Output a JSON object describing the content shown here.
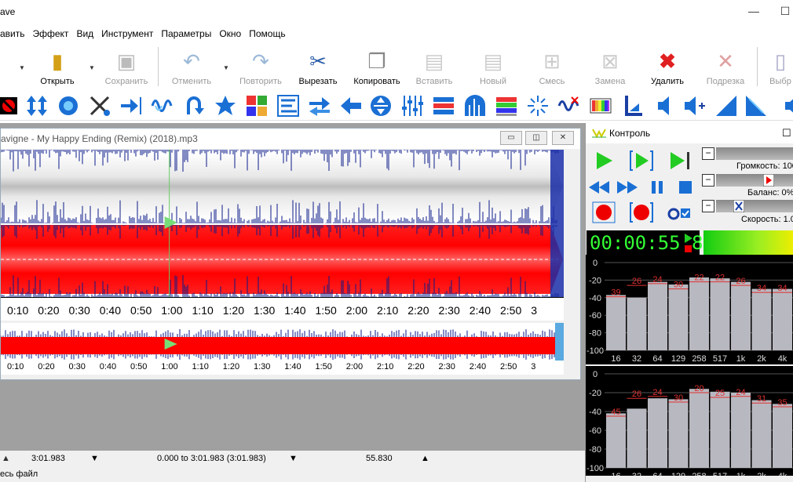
{
  "app": {
    "title": "ave"
  },
  "menu": [
    "авить",
    "Эффект",
    "Вид",
    "Инструмент",
    "Параметры",
    "Окно",
    "Помощь"
  ],
  "toolbar": {
    "open": "Открыть",
    "save": "Сохранить",
    "undo": "Отменить",
    "redo": "Повторить",
    "cut": "Вырезать",
    "copy": "Копировать",
    "paste": "Вставить",
    "new": "Новый",
    "mix": "Смесь",
    "replace": "Замена",
    "delete": "Удалить",
    "trim": "Подрезка",
    "select": "Выбр"
  },
  "document": {
    "title": "avigne - My Happy Ending (Remix) (2018).mp3",
    "ticks": [
      "0:10",
      "0:20",
      "0:30",
      "0:40",
      "0:50",
      "1:00",
      "1:10",
      "1:20",
      "1:30",
      "1:40",
      "1:50",
      "2:00",
      "2:10",
      "2:20",
      "2:30",
      "2:40",
      "2:50",
      "3"
    ],
    "playhead_time": 55.8,
    "duration_seconds": 181.983
  },
  "status": {
    "length": "3:01.983",
    "selection": "0.000 to 3:01.983 (3:01.983)",
    "position": "55.830",
    "hint": "есь файл"
  },
  "control": {
    "title": "Контроль",
    "volume_label": "Громкость: 100",
    "balance_label": "Баланс: 0%",
    "speed_label": "Скорость: 1.0",
    "time": "00:00:55.8"
  },
  "spectrum": {
    "y_ticks": [
      "0",
      "-20",
      "-40",
      "-60",
      "-80",
      "-100"
    ],
    "x_labels": [
      "16",
      "32",
      "64",
      "129",
      "258",
      "517",
      "1k",
      "2k",
      "4k"
    ],
    "top": {
      "peaks": [
        "39",
        "26",
        "24",
        "30",
        "22",
        "22",
        "26",
        "34",
        "34"
      ],
      "levels": [
        -37,
        -40,
        -22,
        -25,
        -17,
        -18,
        -22,
        -30,
        -30
      ]
    },
    "bottom": {
      "peaks": [
        "45",
        "26",
        "24",
        "30",
        "20",
        "25",
        "24",
        "31",
        "35"
      ],
      "levels": [
        -42,
        -37,
        -26,
        -27,
        -16,
        -19,
        -20,
        -28,
        -32
      ]
    }
  },
  "colors": {
    "waveform_top": "#c8c8c8",
    "waveform_bottom": "#ff0000",
    "peak_lines": "#00008b",
    "time_display": "#33ff33"
  }
}
